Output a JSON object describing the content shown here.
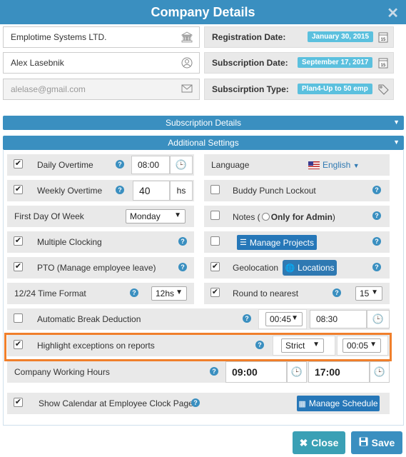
{
  "dialog": {
    "title": "Company Details",
    "close_glyph": "✕"
  },
  "company": {
    "name": "Emplotime Systems LTD.",
    "owner": "Alex Lasebnik",
    "email_placeholder": "alelase@gmail.com",
    "icons": [
      "bank-icon",
      "user-circle-icon",
      "envelope-icon"
    ]
  },
  "registration": {
    "label": "Registration Date:",
    "value": "January 30, 2015"
  },
  "subscription": {
    "label": "Subscription Date:",
    "value": "September 17, 2017"
  },
  "subscription_type": {
    "label": "Subscirption Type:",
    "value": "Plan4-Up to 50 emp"
  },
  "sections": {
    "subscription_details": "Subscription Details",
    "additional_settings": "Additional Settings"
  },
  "settings": {
    "daily_overtime": {
      "label": "Daily Overtime",
      "checked": true,
      "value": "08:00"
    },
    "weekly_overtime": {
      "label": "Weekly Overtime",
      "checked": true,
      "value": "40",
      "unit": "hs"
    },
    "first_day": {
      "label": "First Day Of Week",
      "value": "Monday"
    },
    "multiple_clocking": {
      "label": "Multiple Clocking",
      "checked": true
    },
    "pto": {
      "label": "PTO (Manage employee leave)",
      "checked": true
    },
    "time_format": {
      "label": "12/24 Time Format",
      "value": "12hs"
    },
    "auto_break": {
      "label": "Automatic Break Deduction",
      "checked": false,
      "duration": "00:45",
      "time": "08:30"
    },
    "highlight": {
      "label": "Highlight exceptions on reports",
      "checked": true,
      "mode": "Strict",
      "duration": "00:05"
    },
    "working_hours": {
      "label": "Company Working Hours",
      "start": "09:00",
      "end": "17:00"
    },
    "show_calendar": {
      "label": "Show Calendar at Employee Clock Page",
      "checked": true,
      "button": "Manage Schedule"
    },
    "language": {
      "label": "Language",
      "value": "English"
    },
    "buddy_punch": {
      "label": "Buddy Punch Lockout",
      "checked": false
    },
    "notes": {
      "label": "Notes (",
      "inner_label": "Only for Admin",
      "close_paren": ")",
      "checked": false,
      "inner_checked": false
    },
    "manage_projects": {
      "checked": false,
      "button": "Manage Projects"
    },
    "geolocation": {
      "label": "Geolocation",
      "checked": true,
      "button": "Locations"
    },
    "round": {
      "label": "Round to nearest",
      "checked": true,
      "value": "15"
    }
  },
  "footer": {
    "close_label": "Close",
    "save_label": "Save"
  },
  "colors": {
    "header_blue": "#3a8fc0",
    "pill_cyan": "#5bc0de",
    "highlight_orange": "#f07f2b"
  }
}
